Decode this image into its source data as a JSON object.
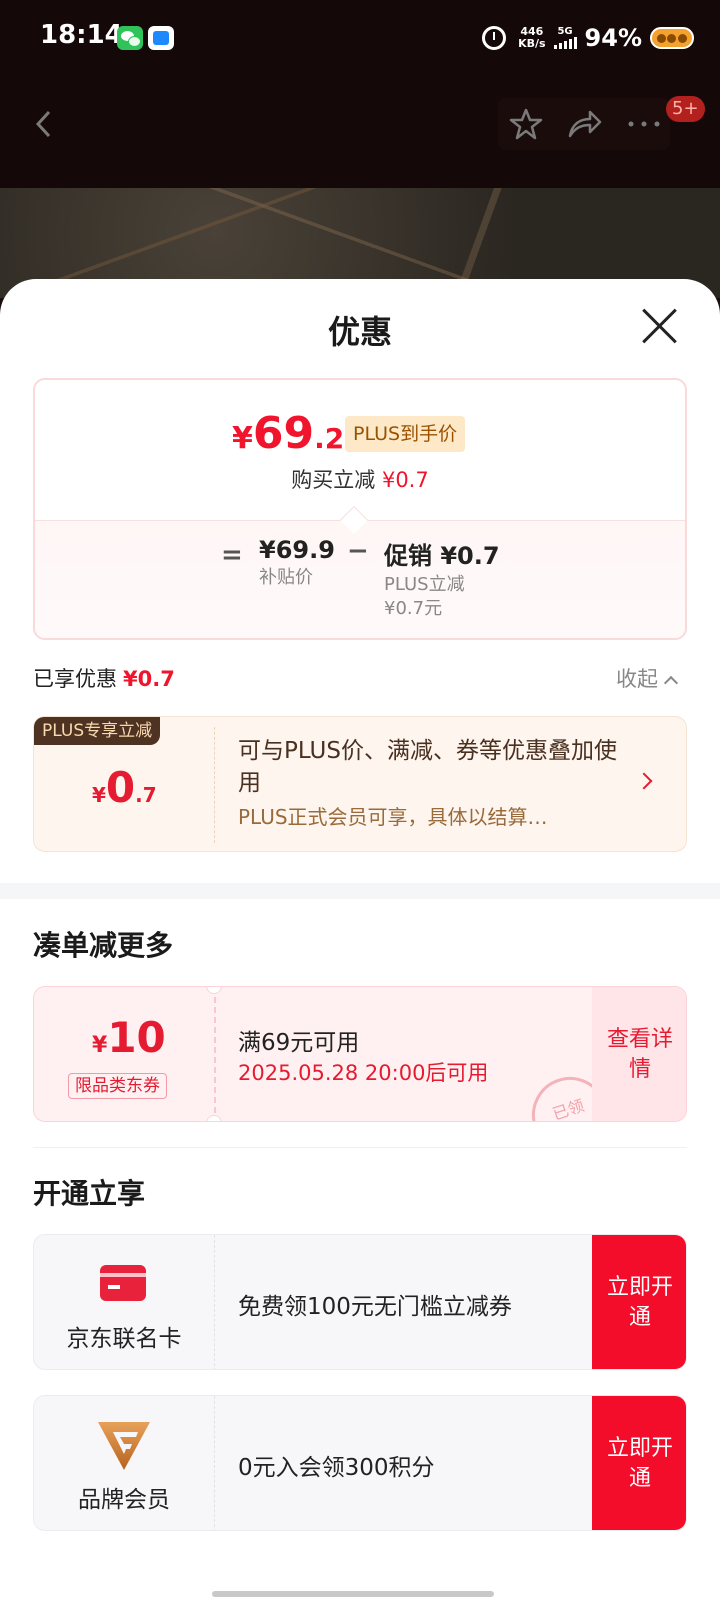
{
  "status_bar": {
    "time": "18:14",
    "net_speed_value": "446",
    "net_speed_unit": "KB/s",
    "network": "5G",
    "battery": "94%"
  },
  "nav": {
    "back_icon": "chevron-left-icon",
    "badge": "5+"
  },
  "sheet": {
    "title": "优惠"
  },
  "price_card": {
    "currency": "¥",
    "final_int": "69",
    "final_dec": ".2",
    "plus_tag": "PLUS到手价",
    "buy_cut_label": "购买立减",
    "buy_cut_value": "¥0.7",
    "equals": "=",
    "subsidy_value": "¥69.9",
    "subsidy_label": "补贴价",
    "minus": "−",
    "promo_value": "促销 ¥0.7",
    "promo_line1": "PLUS立减",
    "promo_line2": "¥0.7元"
  },
  "enjoyed": {
    "label": "已享优惠",
    "value": "¥0.7",
    "collapse": "收起"
  },
  "plus_card": {
    "label": "PLUS专享立减",
    "currency": "¥",
    "amount_int": "0",
    "amount_dec": ".7",
    "desc1": "可与PLUS价、满减、券等优惠叠加使用",
    "desc2": "PLUS正式会员可享，具体以结算…"
  },
  "more_section": {
    "title": "凑单减更多",
    "coupon": {
      "currency": "¥",
      "amount": "10",
      "type": "限品类东券",
      "condition": "满69元可用",
      "time": "2025.05.28 20:00后可用",
      "stamp": "已领",
      "button": "查看详情"
    }
  },
  "open_section": {
    "title": "开通立享",
    "items": [
      {
        "name": "京东联名卡",
        "desc": "免费领100元无门槛立减券",
        "button": "立即开通",
        "icon": "credit-card-icon"
      },
      {
        "name": "品牌会员",
        "desc": "0元入会领300积分",
        "button": "立即开通",
        "icon": "brand-v-icon"
      }
    ]
  },
  "colors": {
    "accent_red": "#f0142d",
    "plus_gold": "#9a5200",
    "button_red": "#f40d2a"
  }
}
